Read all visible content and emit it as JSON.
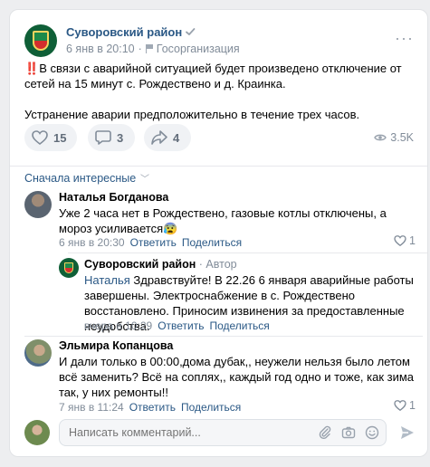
{
  "post": {
    "author": "Суворовский район",
    "date": "6 янв в 20:10",
    "category": "Госорганизация",
    "text_line1_icon": "‼️",
    "text_p1": "В связи с аварийной ситуацией будет произведено отключение от сетей на 15 минут с. Рождествено и д. Краинка.",
    "text_p2": "Устранение аварии предположительно в течение трех часов.",
    "likes": "15",
    "comments": "3",
    "shares": "4",
    "views": "3.5K"
  },
  "comments_sort": "Сначала интересные",
  "comments": [
    {
      "name": "Наталья Богданова",
      "text": "Уже 2 часа нет в Рождествено, газовые котлы отключены, а мороз усиливается😰",
      "date": "6 янв в 20:30",
      "reply": "Ответить",
      "share": "Поделиться",
      "likes": "1"
    },
    {
      "name": "Суворовский район",
      "role": "· Автор",
      "reply_to": "Наталья",
      "text": " Здравствуйте! В 22.26 6 января аварийные работы завершены. Электроснабжение в с. Рождествено восстановлено. Приносим извинения за предоставленные неудобства.",
      "date": "вчера в 10:29",
      "reply": "Ответить",
      "share": "Поделиться"
    },
    {
      "name": "Эльмира Копанцова",
      "text": "И дали только в 00:00,дома дубак,, неужели нельзя было летом всё заменить? Всё на соплях,, каждый год одно и тоже, как зима так, у них ремонты!!",
      "date": "7 янв в 11:24",
      "reply": "Ответить",
      "share": "Поделиться",
      "likes": "1"
    }
  ],
  "comment_input": {
    "placeholder": "Написать комментарий..."
  },
  "colors": {
    "link": "#2a5885",
    "meta": "#818c99",
    "background": "#edeef0"
  }
}
